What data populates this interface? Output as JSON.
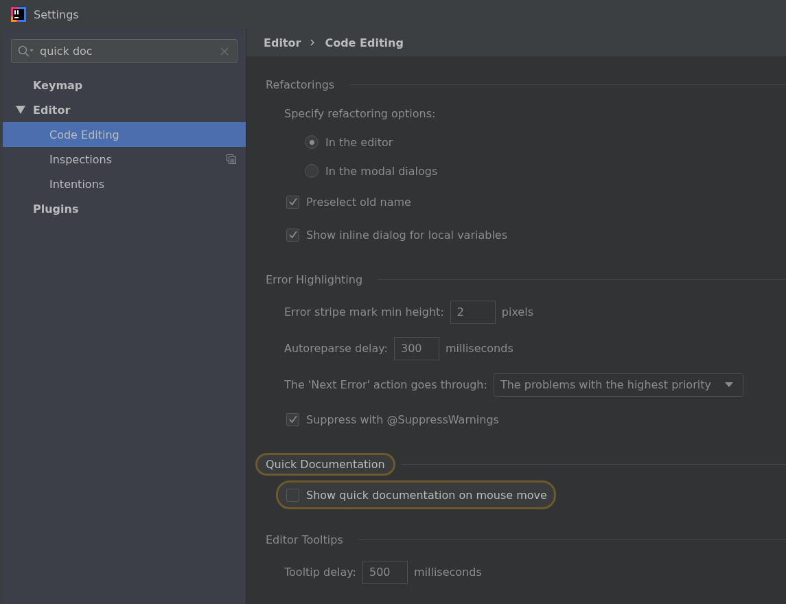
{
  "window": {
    "title": "Settings"
  },
  "search": {
    "value": "quick doc"
  },
  "sidebar": {
    "items": [
      {
        "label": "Keymap",
        "selected": false
      },
      {
        "label": "Editor",
        "expanded": true,
        "selected": false,
        "children": [
          {
            "label": "Code Editing",
            "selected": true,
            "icon": false
          },
          {
            "label": "Inspections",
            "selected": false,
            "icon": true
          },
          {
            "label": "Intentions",
            "selected": false,
            "icon": false
          }
        ]
      },
      {
        "label": "Plugins",
        "selected": false
      }
    ]
  },
  "breadcrumb": [
    "Editor",
    "Code Editing"
  ],
  "sections": [
    {
      "title": "Refactorings",
      "highlighted": false,
      "items": [
        {
          "kind": "label",
          "text": "Specify refactoring options:",
          "highlighted": false
        },
        {
          "kind": "radio",
          "text": "In the editor",
          "selected": true,
          "highlighted": false
        },
        {
          "kind": "radio",
          "text": "In the modal dialogs",
          "selected": false,
          "highlighted": false
        },
        {
          "kind": "checkbox",
          "text": "Preselect old name",
          "checked": true,
          "highlighted": false
        },
        {
          "kind": "checkbox",
          "text": "Show inline dialog for local variables",
          "checked": true,
          "highlighted": false
        }
      ]
    },
    {
      "title": "Error Highlighting",
      "highlighted": false,
      "items": [
        {
          "kind": "number",
          "text": "Error stripe mark min height:",
          "value": "2",
          "unit": "pixels",
          "highlighted": false
        },
        {
          "kind": "number",
          "text": "Autoreparse delay:",
          "value": "300",
          "unit": "milliseconds",
          "highlighted": false
        },
        {
          "kind": "dropdown",
          "text": "The 'Next Error' action goes through:",
          "value": "The problems with the highest priority",
          "highlighted": false
        },
        {
          "kind": "checkbox",
          "text": "Suppress with @SuppressWarnings",
          "checked": true,
          "highlighted": false
        }
      ]
    },
    {
      "title": "Quick Documentation",
      "highlighted": true,
      "items": [
        {
          "kind": "checkbox",
          "text": "Show quick documentation on mouse move",
          "checked": false,
          "highlighted": true
        }
      ]
    },
    {
      "title": "Editor Tooltips",
      "highlighted": false,
      "items": [
        {
          "kind": "number",
          "text": "Tooltip delay:",
          "value": "500",
          "unit": "milliseconds",
          "highlighted": false
        }
      ]
    }
  ]
}
